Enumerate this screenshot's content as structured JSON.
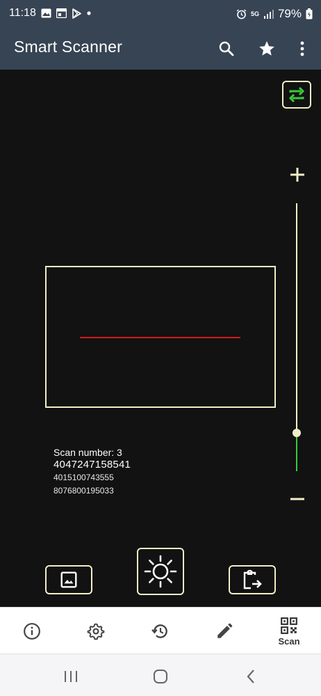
{
  "status_bar": {
    "time": "11:18",
    "network": "5G",
    "battery": "79%"
  },
  "app_bar": {
    "title": "Smart Scanner",
    "actions": [
      "search-icon",
      "star-icon",
      "more-vert-icon"
    ]
  },
  "scan": {
    "number_label": "Scan number: 3",
    "main_code": "4047247158541",
    "history": [
      "4015100743555",
      "8076800195033"
    ]
  },
  "zoom": {
    "plus": "+",
    "minus": "–",
    "level": 0.15
  },
  "bottom_nav": {
    "items": [
      {
        "icon": "info-icon",
        "label": ""
      },
      {
        "icon": "settings-icon",
        "label": ""
      },
      {
        "icon": "history-icon",
        "label": ""
      },
      {
        "icon": "edit-icon",
        "label": ""
      },
      {
        "icon": "qr-code-icon",
        "label": "Scan"
      }
    ]
  },
  "colors": {
    "app_bar": "#374454",
    "accent_frame": "#f2eec7",
    "scan_line": "#d11b1b",
    "zoom_fill": "#39c83a",
    "switch_icon": "#39c83a"
  }
}
